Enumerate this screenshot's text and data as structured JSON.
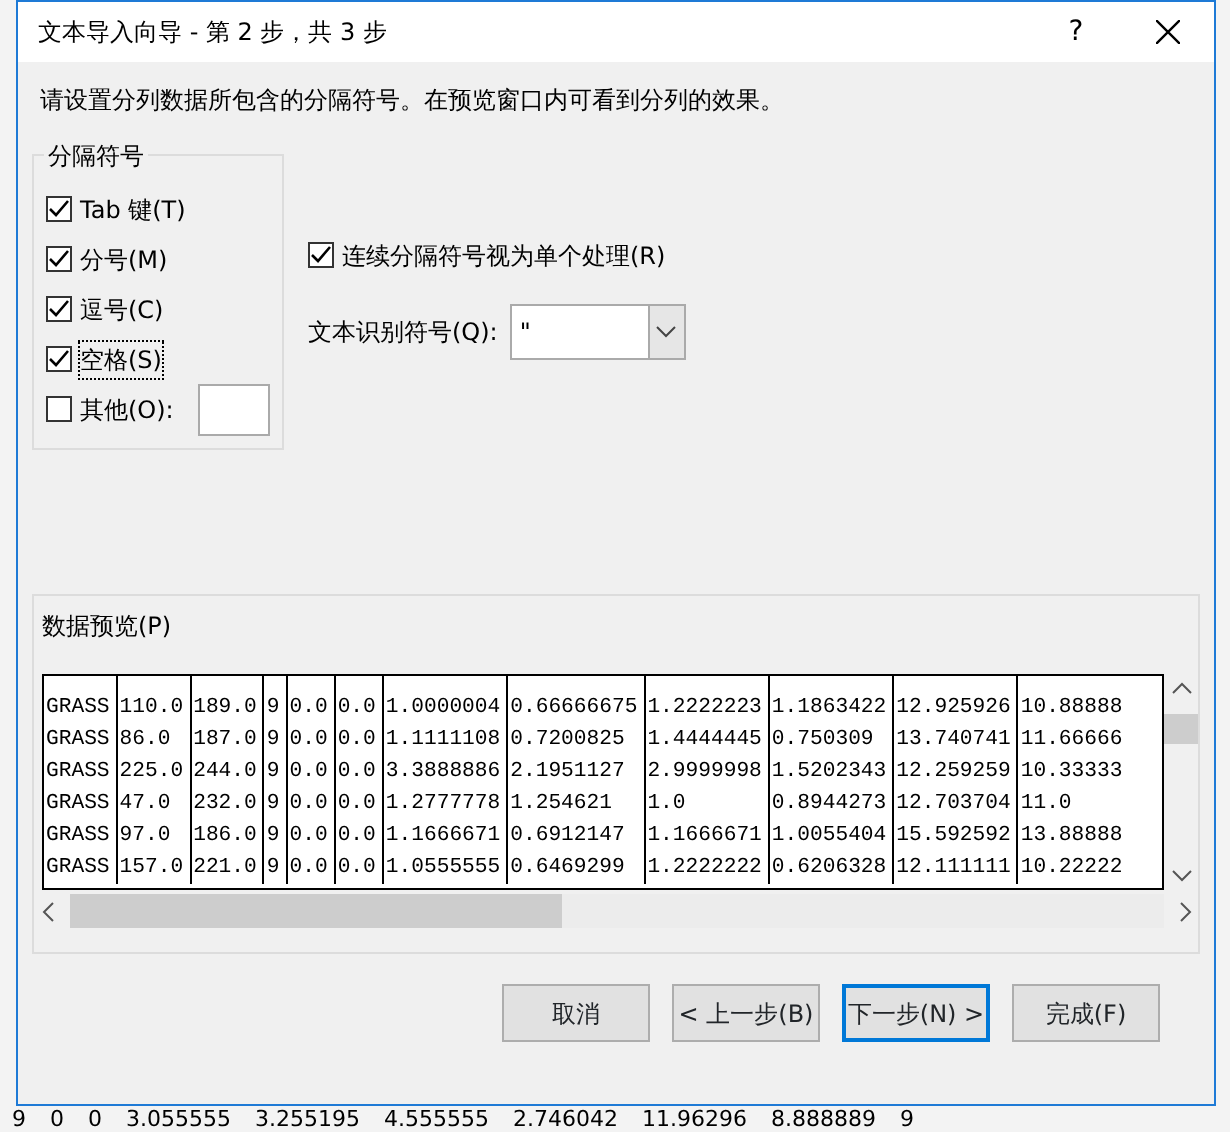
{
  "window": {
    "title": "文本导入向导 - 第 2 步，共 3 步",
    "help": "?"
  },
  "instruction": "请设置分列数据所包含的分隔符号。在预览窗口内可看到分列的效果。",
  "delimiters": {
    "title": "分隔符号",
    "options": [
      {
        "label": "Tab 键(T)",
        "checked": true,
        "focused": false,
        "kind": "plain"
      },
      {
        "label": "分号(M)",
        "checked": true,
        "focused": false,
        "kind": "plain"
      },
      {
        "label": "逗号(C)",
        "checked": true,
        "focused": false,
        "kind": "plain"
      },
      {
        "label": "空格(S)",
        "checked": true,
        "focused": true,
        "kind": "plain"
      },
      {
        "label": "其他(O):",
        "checked": false,
        "focused": false,
        "kind": "input"
      }
    ]
  },
  "consecutive": {
    "label": "连续分隔符号视为单个处理(R)",
    "checked": true
  },
  "qualifier": {
    "label": "文本识别符号(Q):",
    "value": "\""
  },
  "preview": {
    "title": "数据预览(P)",
    "rows": [
      [
        "GRASS",
        "110.0",
        "189.0",
        "9",
        "0.0",
        "0.0",
        "1.0000004",
        "0.66666675",
        "1.2222223",
        "1.1863422",
        "12.925926",
        "10.88888"
      ],
      [
        "GRASS",
        "86.0",
        "187.0",
        "9",
        "0.0",
        "0.0",
        "1.1111108",
        "0.7200825",
        "1.4444445",
        "0.750309",
        "13.740741",
        "11.66666"
      ],
      [
        "GRASS",
        "225.0",
        "244.0",
        "9",
        "0.0",
        "0.0",
        "3.3888886",
        "2.1951127",
        "2.9999998",
        "1.5202343",
        "12.259259",
        "10.33333"
      ],
      [
        "GRASS",
        "47.0",
        "232.0",
        "9",
        "0.0",
        "0.0",
        "1.2777778",
        "1.254621",
        "1.0",
        "0.8944273",
        "12.703704",
        "11.0"
      ],
      [
        "GRASS",
        "97.0",
        "186.0",
        "9",
        "0.0",
        "0.0",
        "1.1666671",
        "0.6912147",
        "1.1666671",
        "1.0055404",
        "15.592592",
        "13.88888"
      ],
      [
        "GRASS",
        "157.0",
        "221.0",
        "9",
        "0.0",
        "0.0",
        "1.0555555",
        "0.6469299",
        "1.2222222",
        "0.6206328",
        "12.111111",
        "10.22222"
      ]
    ],
    "hscroll": {
      "level": 0.45
    }
  },
  "buttons": [
    {
      "label": "取消",
      "default": false
    },
    {
      "label": "< 上一步(B)",
      "default": false
    },
    {
      "label": "下一步(N) >",
      "default": true
    },
    {
      "label": "完成(F)",
      "default": false
    }
  ],
  "background_row": [
    "9",
    "0",
    "0",
    "3.055555",
    "3.255195",
    "4.555555",
    "2.746042",
    "11.96296",
    "8.888889",
    "9"
  ]
}
